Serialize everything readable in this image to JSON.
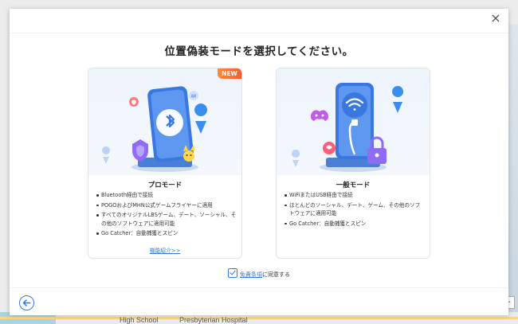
{
  "dialog": {
    "title": "位置偽装モードを選択してください。",
    "close_symbol": "×"
  },
  "cards": [
    {
      "badge": "NEW",
      "heading": "プロモード",
      "features": [
        "Bluetooth経由で接続",
        "POGOおよびMHN公式ゲームフライヤーに適用",
        "すべてのオリジナルLBSゲーム、デート、ソーシャル、その他のソフトウェアに適用可能",
        "Go Catcher：自動捕獲とスピン"
      ],
      "link": "機能紹介>>",
      "icon": "bluetooth-icon"
    },
    {
      "heading": "一般モード",
      "features": [
        "WiFiまたはUSB経由で接続",
        "ほとんどのソーシャル、デート、ゲーム、その他のソフトウェアに適用可能",
        "Go Catcher：自動捕獲とスピン"
      ],
      "icon": "wifi-icon"
    }
  ],
  "agreement": {
    "link_text": "免責条項",
    "suffix": "に同意する",
    "checked": true
  },
  "map": {
    "label_school": "High School",
    "label_hospital": "Presbyterian Hospital",
    "zoom_symbol": "–"
  },
  "colors": {
    "accent": "#2f7ad9",
    "badge": "#ff6a30",
    "card_bg": "#eef4fc"
  }
}
